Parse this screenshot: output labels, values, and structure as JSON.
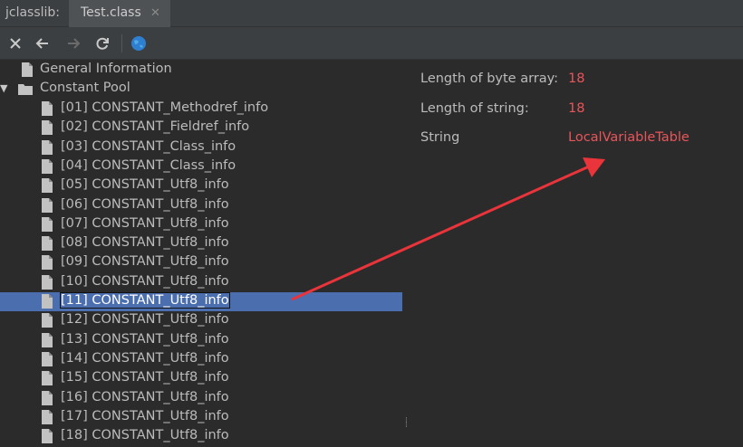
{
  "app_name": "jclasslib:",
  "tab": {
    "title": "Test.class",
    "close_glyph": "✕"
  },
  "toolbar": {
    "buttons": [
      {
        "icon": "close-icon",
        "label": "Close"
      },
      {
        "icon": "back-arrow-icon",
        "label": "Back"
      },
      {
        "icon": "forward-arrow-icon",
        "label": "Forward"
      },
      {
        "icon": "refresh-icon",
        "label": "Reload"
      },
      {
        "icon": "globe-icon",
        "label": "Browse"
      }
    ]
  },
  "tree": {
    "general_information": "General Information",
    "constant_pool": "Constant Pool",
    "items": [
      "[01] CONSTANT_Methodref_info",
      "[02] CONSTANT_Fieldref_info",
      "[03] CONSTANT_Class_info",
      "[04] CONSTANT_Class_info",
      "[05] CONSTANT_Utf8_info",
      "[06] CONSTANT_Utf8_info",
      "[07] CONSTANT_Utf8_info",
      "[08] CONSTANT_Utf8_info",
      "[09] CONSTANT_Utf8_info",
      "[10] CONSTANT_Utf8_info",
      "[11] CONSTANT_Utf8_info",
      "[12] CONSTANT_Utf8_info",
      "[13] CONSTANT_Utf8_info",
      "[14] CONSTANT_Utf8_info",
      "[15] CONSTANT_Utf8_info",
      "[16] CONSTANT_Utf8_info",
      "[17] CONSTANT_Utf8_info",
      "[18] CONSTANT_Utf8_info"
    ],
    "selected_item": "[11] CONSTANT_Utf8_info"
  },
  "details": {
    "byte_array_length_label": "Length of byte array:",
    "byte_array_length_value": "18",
    "string_length_label": "Length of string:",
    "string_length_value": "18",
    "string_label": "String",
    "string_value": "LocalVariableTable"
  },
  "colors": {
    "value_red": "#e8555b",
    "selection_blue": "#4b6eaf",
    "annotation_arrow": "#e8343a"
  }
}
